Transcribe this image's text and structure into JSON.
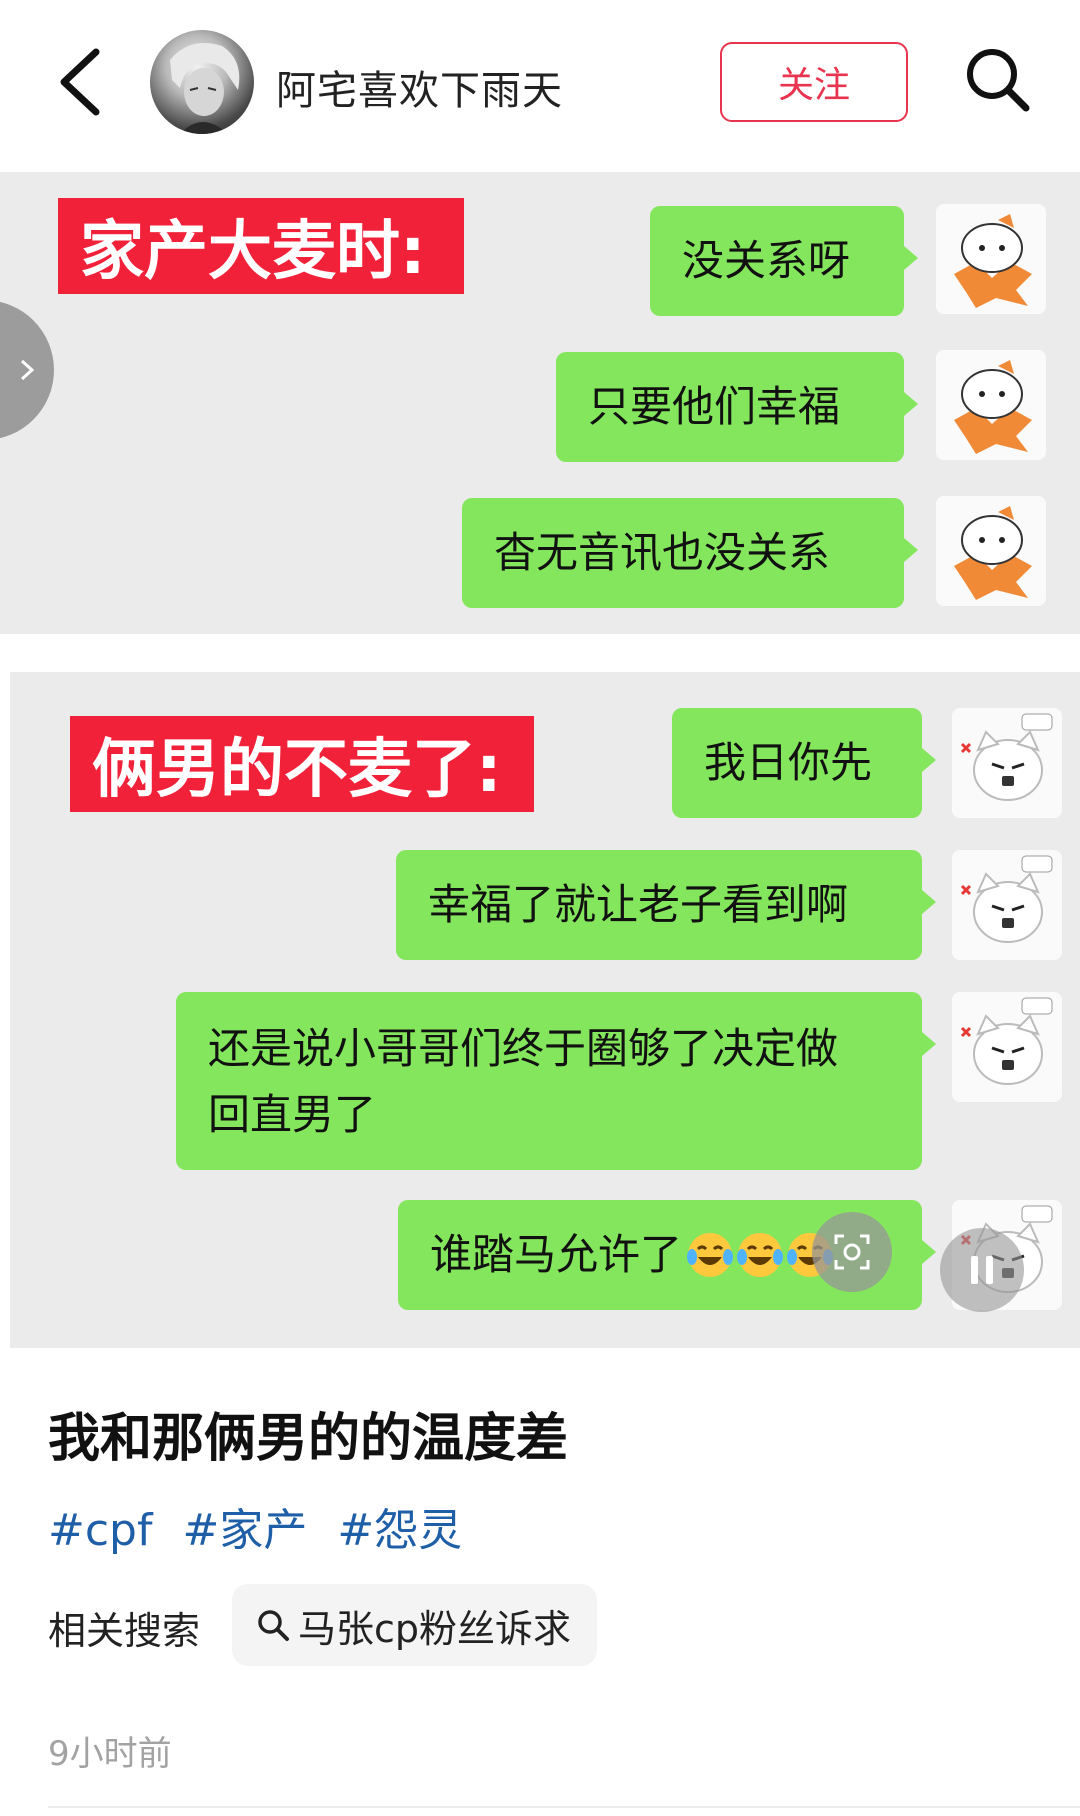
{
  "header": {
    "username": "阿宅喜欢下雨天",
    "follow_label": "关注"
  },
  "panel1": {
    "tag": "家产大麦时:",
    "messages": [
      "没关系呀",
      "只要他们幸福",
      "杳无音讯也没关系"
    ]
  },
  "panel2": {
    "tag": "俩男的不麦了:",
    "messages": [
      "我日你先",
      "幸福了就让老子看到啊",
      "还是说小哥哥们终于圈够了决定做",
      "回直男了",
      "谁踏马允许了"
    ]
  },
  "post": {
    "title": "我和那俩男的的温度差",
    "tags": [
      "#cpf",
      "#家产",
      "#怨灵"
    ],
    "related_label": "相关搜索",
    "related_query": "马张cp粉丝诉求",
    "timestamp": "9小时前"
  },
  "colors": {
    "accent": "#e8344e",
    "bubble": "#84e65c",
    "tag_red": "#f2213a",
    "link": "#1f5fa8"
  },
  "icons": [
    "back-arrow-icon",
    "search-icon",
    "chevron-right-icon",
    "laugh-cry-emoji",
    "scan-icon",
    "pause-icon"
  ]
}
